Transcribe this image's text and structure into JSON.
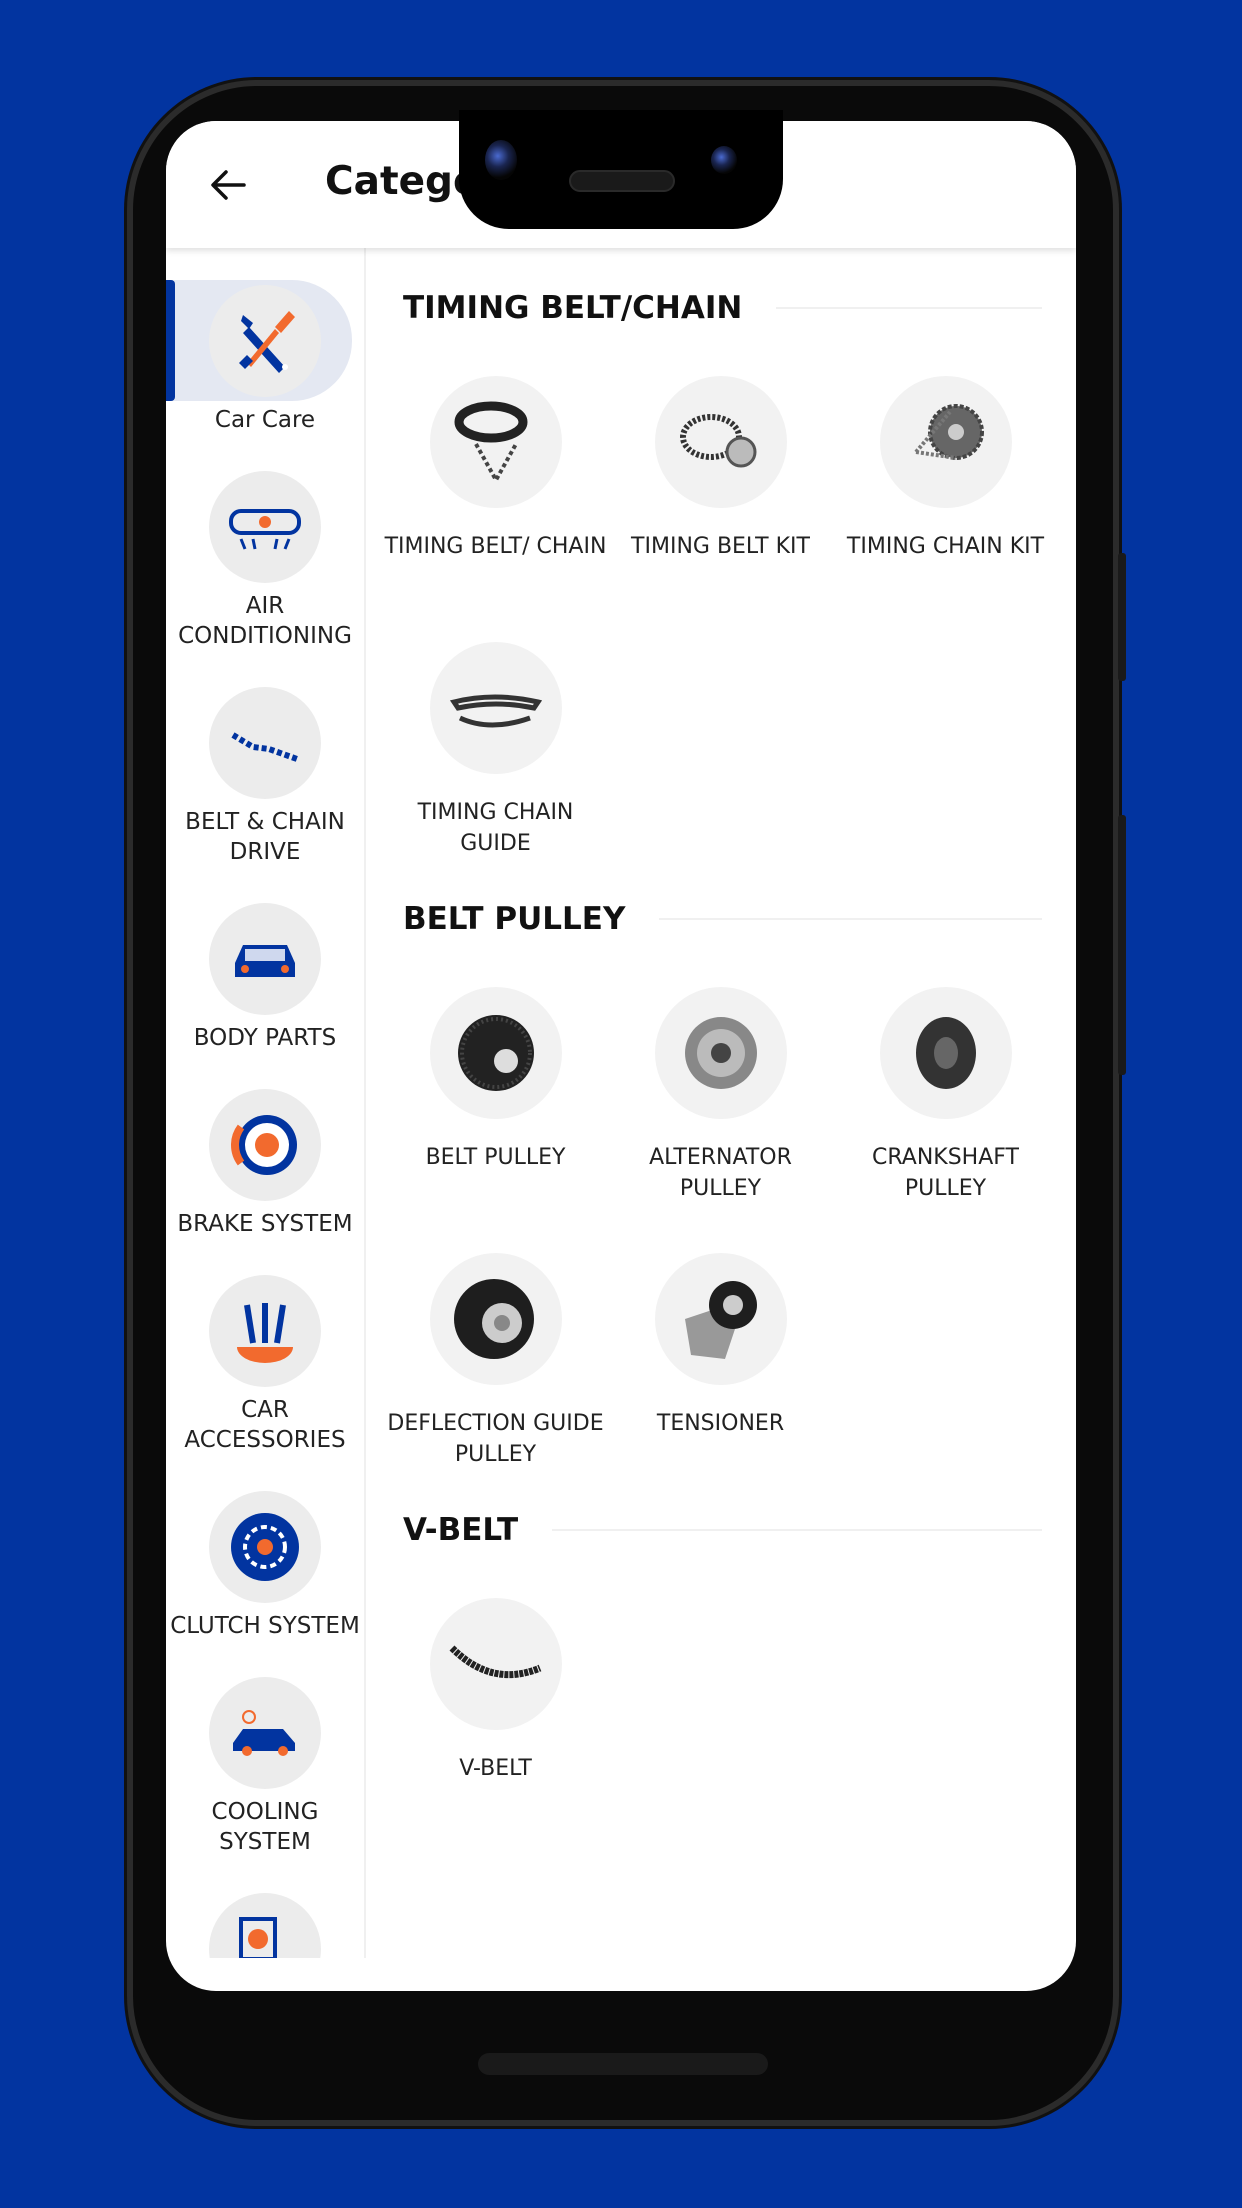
{
  "header": {
    "title": "Catego",
    "back_icon": "arrow-left-icon"
  },
  "colors": {
    "background": "#0234a0",
    "accent": "#0234a0",
    "orange": "#f26a2e"
  },
  "sidebar": {
    "items": [
      {
        "label": "Car Care",
        "icon": "wrench-screwdriver-icon",
        "selected": true
      },
      {
        "label": "AIR CONDITIONING",
        "icon": "air-vent-icon"
      },
      {
        "label": "BELT & CHAIN DRIVE",
        "icon": "chain-icon"
      },
      {
        "label": "BODY PARTS",
        "icon": "car-front-icon"
      },
      {
        "label": "BRAKE SYSTEM",
        "icon": "brake-disc-icon"
      },
      {
        "label": "CAR ACCESSORIES",
        "icon": "tools-icon"
      },
      {
        "label": "CLUTCH SYSTEM",
        "icon": "clutch-plate-icon"
      },
      {
        "label": "COOLING SYSTEM",
        "icon": "car-cooling-icon"
      },
      {
        "label": "",
        "icon": "partial-icon"
      }
    ]
  },
  "sections": [
    {
      "title": "TIMING BELT/CHAIN",
      "items": [
        {
          "label": "TIMING BELT/ CHAIN"
        },
        {
          "label": "TIMING BELT KIT"
        },
        {
          "label": "TIMING CHAIN KIT"
        },
        {
          "label": "TIMING CHAIN GUIDE"
        }
      ]
    },
    {
      "title": "BELT PULLEY",
      "items": [
        {
          "label": "BELT PULLEY"
        },
        {
          "label": "ALTERNATOR PULLEY"
        },
        {
          "label": "CRANKSHAFT PULLEY"
        },
        {
          "label": "DEFLECTION GUIDE PULLEY"
        },
        {
          "label": "TENSIONER"
        }
      ]
    },
    {
      "title": "V-BELT",
      "items": [
        {
          "label": "V-BELT"
        }
      ]
    }
  ]
}
